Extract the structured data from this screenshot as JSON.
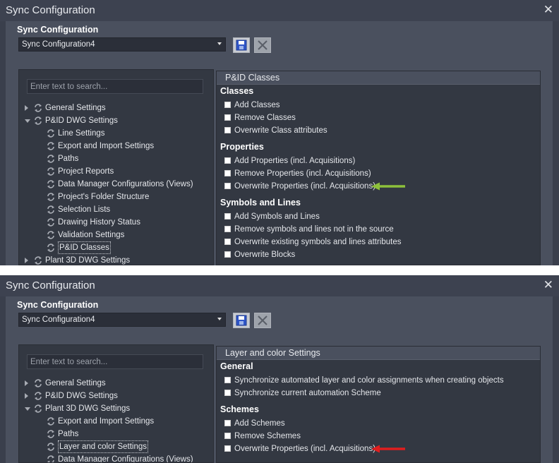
{
  "windows": [
    {
      "title": "Sync Configuration",
      "section_label": "Sync Configuration",
      "config_select": {
        "value": "Sync Configuration4"
      },
      "search": {
        "placeholder": "Enter text to search..."
      },
      "tree": [
        {
          "label": "General Settings",
          "level": 0,
          "expander": "collapsed",
          "selected": false
        },
        {
          "label": "P&ID DWG Settings",
          "level": 0,
          "expander": "expanded",
          "selected": false
        },
        {
          "label": "Line Settings",
          "level": 1,
          "expander": "none",
          "selected": false
        },
        {
          "label": "Export and Import Settings",
          "level": 1,
          "expander": "none",
          "selected": false
        },
        {
          "label": "Paths",
          "level": 1,
          "expander": "none",
          "selected": false
        },
        {
          "label": "Project Reports",
          "level": 1,
          "expander": "none",
          "selected": false
        },
        {
          "label": "Data Manager Configurations (Views)",
          "level": 1,
          "expander": "none",
          "selected": false
        },
        {
          "label": "Project's Folder Structure",
          "level": 1,
          "expander": "none",
          "selected": false
        },
        {
          "label": "Selection Lists",
          "level": 1,
          "expander": "none",
          "selected": false
        },
        {
          "label": "Drawing History Status",
          "level": 1,
          "expander": "none",
          "selected": false
        },
        {
          "label": "Validation Settings",
          "level": 1,
          "expander": "none",
          "selected": false
        },
        {
          "label": "P&ID Classes",
          "level": 1,
          "expander": "none",
          "selected": true
        },
        {
          "label": "Plant 3D DWG Settings",
          "level": 0,
          "expander": "collapsed",
          "selected": false
        }
      ],
      "panel_title": "P&ID Classes",
      "groups": [
        {
          "title": "Classes",
          "options": [
            "Add Classes",
            "Remove Classes",
            "Overwrite Class attributes"
          ]
        },
        {
          "title": "Properties",
          "options": [
            "Add Properties (incl. Acquisitions)",
            "Remove Properties (incl. Acquisitions)",
            "Overwrite Properties (incl. Acquisitions)"
          ]
        },
        {
          "title": "Symbols and Lines",
          "options": [
            "Add Symbols and Lines",
            "Remove symbols and lines not in the source",
            "Overwrite existing symbols and lines attributes",
            "Overwrite Blocks"
          ]
        }
      ],
      "annotation": {
        "color": "#8dc03b",
        "target_option": "Overwrite Properties (incl. Acquisitions)"
      }
    },
    {
      "title": "Sync Configuration",
      "section_label": "Sync Configuration",
      "config_select": {
        "value": "Sync Configuration4"
      },
      "search": {
        "placeholder": "Enter text to search..."
      },
      "tree": [
        {
          "label": "General Settings",
          "level": 0,
          "expander": "collapsed",
          "selected": false
        },
        {
          "label": "P&ID DWG Settings",
          "level": 0,
          "expander": "collapsed",
          "selected": false
        },
        {
          "label": "Plant 3D DWG Settings",
          "level": 0,
          "expander": "expanded",
          "selected": false
        },
        {
          "label": "Export and Import Settings",
          "level": 1,
          "expander": "none",
          "selected": false
        },
        {
          "label": "Paths",
          "level": 1,
          "expander": "none",
          "selected": false
        },
        {
          "label": "Layer and color Settings",
          "level": 1,
          "expander": "none",
          "selected": true
        },
        {
          "label": "Data Manager Configurations (Views)",
          "level": 1,
          "expander": "none",
          "selected": false
        }
      ],
      "panel_title": "Layer and color Settings",
      "groups": [
        {
          "title": "General",
          "options": [
            "Synchronize automated layer and color assignments when creating objects",
            "Synchronize current automation Scheme"
          ]
        },
        {
          "title": "Schemes",
          "options": [
            "Add Schemes",
            "Remove Schemes",
            "Overwrite Properties (incl. Acquisitions)"
          ]
        }
      ],
      "annotation": {
        "color": "#e01e1e",
        "target_option": "Overwrite Properties (incl. Acquisitions)"
      }
    }
  ],
  "icons": {
    "close": "close-icon",
    "save": "save-icon",
    "delete": "delete-icon",
    "sync": "sync-icon",
    "expand": "expander-icon"
  },
  "colors": {
    "window_bg": "#3a3f4c",
    "pane_bg": "#333842",
    "text": "#e4e6ea"
  }
}
